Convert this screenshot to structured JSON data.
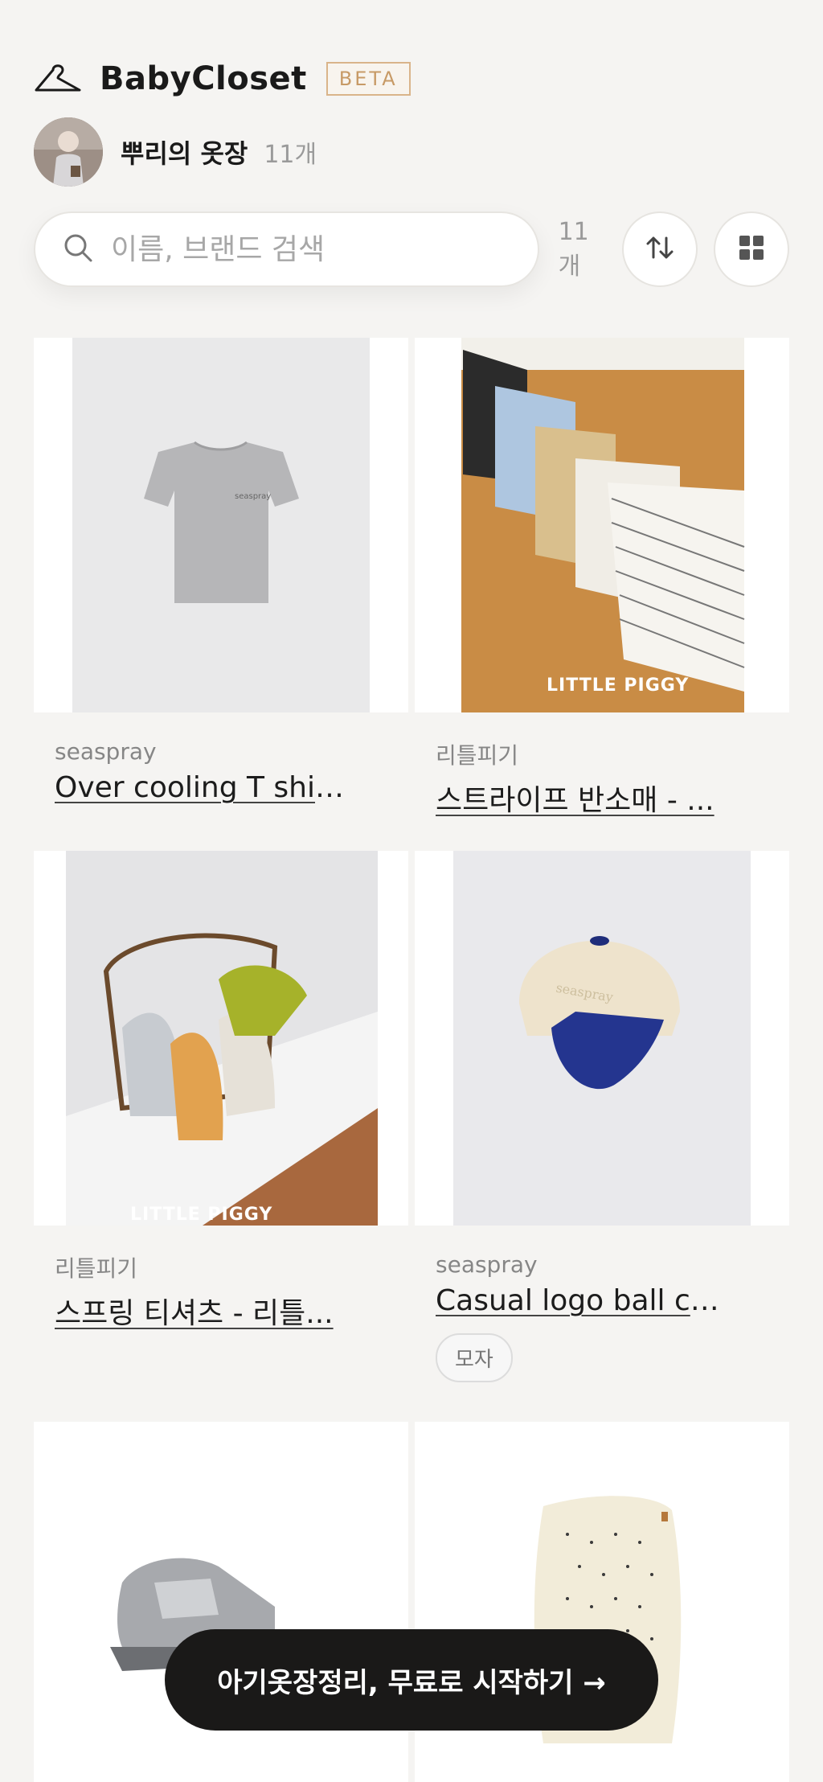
{
  "header": {
    "app_name": "BabyCloset",
    "badge": "BETA",
    "icon": "hanger-icon"
  },
  "closet": {
    "name": "뿌리의 옷장",
    "count": "11개"
  },
  "search": {
    "placeholder": "이름, 브랜드 검색",
    "value": "",
    "result_count": "11개"
  },
  "toolbar": {
    "sort_icon": "sort-arrows-icon",
    "view_icon": "grid-view-icon"
  },
  "products": [
    {
      "brand": "seaspray",
      "title": "Over cooling T shir..."
    },
    {
      "brand": "리틀피기",
      "title": "스트라이프 반소매 - ...",
      "watermark": "LITTLE PIGGY"
    },
    {
      "brand": "리틀피기",
      "title": "스프링 티셔츠 - 리틀...",
      "watermark": "LITTLE PIGGY"
    },
    {
      "brand": "seaspray",
      "title": "Casual logo ball ca...",
      "tag": "모자"
    },
    {
      "brand": "",
      "title": ""
    },
    {
      "brand": "",
      "title": ""
    }
  ],
  "cta": {
    "label": "아기옷장정리, 무료로 시작하기 →"
  },
  "colors": {
    "background": "#f5f4f2",
    "beta_accent": "#c79a66",
    "cta_background": "#1a1918"
  }
}
